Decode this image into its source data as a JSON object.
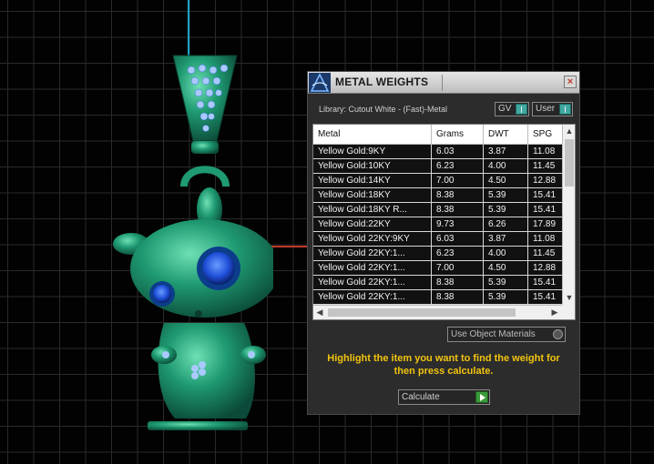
{
  "window": {
    "title": "METAL WEIGHTS",
    "close_icon": "close-icon",
    "logo_icon": "app-logo-icon"
  },
  "library_label": "Library: Cutout White - (Fast)-Metal",
  "toggles": {
    "gv": "GV",
    "user": "User"
  },
  "table": {
    "columns": [
      "Metal",
      "Grams",
      "DWT",
      "SPG"
    ],
    "rows": [
      {
        "metal": "Yellow Gold:9KY",
        "grams": "6.03",
        "dwt": "3.87",
        "spg": "11.08"
      },
      {
        "metal": "Yellow Gold:10KY",
        "grams": "6.23",
        "dwt": "4.00",
        "spg": "11.45"
      },
      {
        "metal": "Yellow Gold:14KY",
        "grams": "7.00",
        "dwt": "4.50",
        "spg": "12.88"
      },
      {
        "metal": "Yellow Gold:18KY",
        "grams": "8.38",
        "dwt": "5.39",
        "spg": "15.41"
      },
      {
        "metal": "Yellow Gold:18KY R...",
        "grams": "8.38",
        "dwt": "5.39",
        "spg": "15.41"
      },
      {
        "metal": "Yellow Gold:22KY",
        "grams": "9.73",
        "dwt": "6.26",
        "spg": "17.89"
      },
      {
        "metal": "Yellow Gold 22KY:9KY",
        "grams": "6.03",
        "dwt": "3.87",
        "spg": "11.08"
      },
      {
        "metal": "Yellow Gold 22KY:1...",
        "grams": "6.23",
        "dwt": "4.00",
        "spg": "11.45"
      },
      {
        "metal": "Yellow Gold 22KY:1...",
        "grams": "7.00",
        "dwt": "4.50",
        "spg": "12.88"
      },
      {
        "metal": "Yellow Gold 22KY:1...",
        "grams": "8.38",
        "dwt": "5.39",
        "spg": "15.41"
      },
      {
        "metal": "Yellow Gold 22KY:1...",
        "grams": "8.38",
        "dwt": "5.39",
        "spg": "15.41"
      }
    ]
  },
  "use_object_materials": "Use Object Materials",
  "hint": "Highlight the item you want to find the weight for then press calculate.",
  "calculate": "Calculate",
  "colors": {
    "hint": "#f1c40f",
    "model_green": "#1a8a6a",
    "gem_blue": "#1f4fd8",
    "axis_blue": "#19a6c4",
    "axis_red": "#c0392b"
  }
}
